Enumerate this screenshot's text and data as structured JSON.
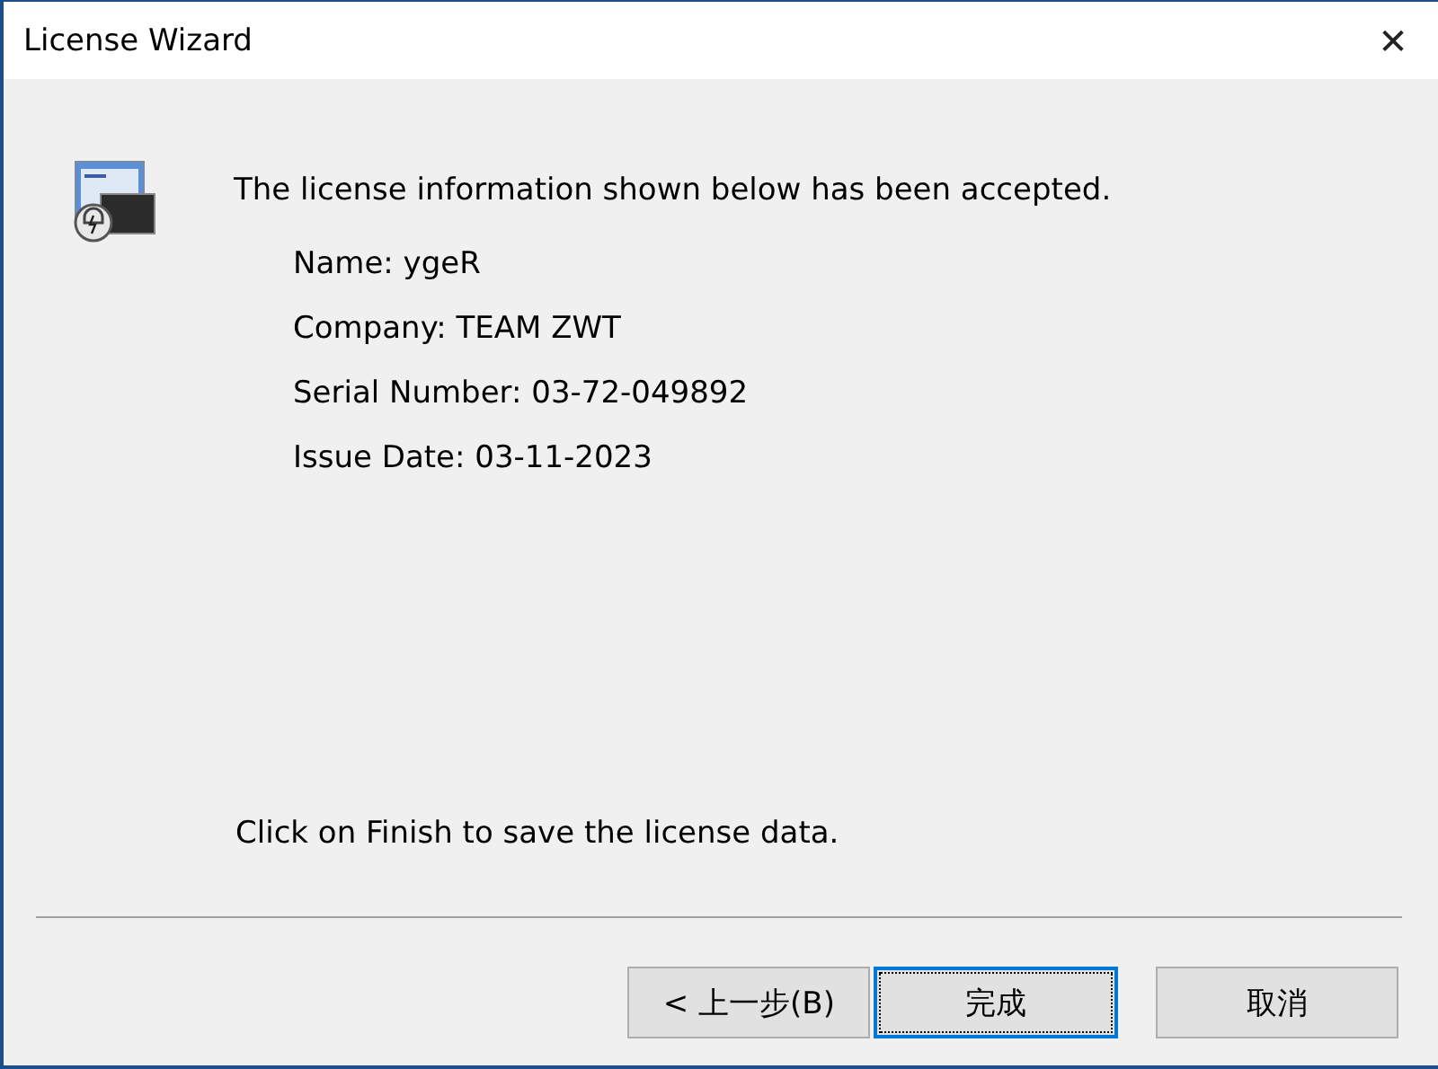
{
  "window": {
    "title": "License Wizard",
    "close": "✕"
  },
  "message": "The license information shown below has been accepted.",
  "details": [
    {
      "label": "Name:",
      "value": "ygeR"
    },
    {
      "label": "Company:",
      "value": "TEAM ZWT"
    },
    {
      "label": "Serial Number:",
      "value": "03-72-049892"
    },
    {
      "label": "Issue Date:",
      "value": "03-11-2023"
    }
  ],
  "instruction": "Click on Finish to save the license data.",
  "buttons": [
    {
      "label": "< 上一步(B)",
      "default": false
    },
    {
      "label": "完成",
      "default": true
    },
    {
      "label": "取消",
      "default": false
    }
  ]
}
